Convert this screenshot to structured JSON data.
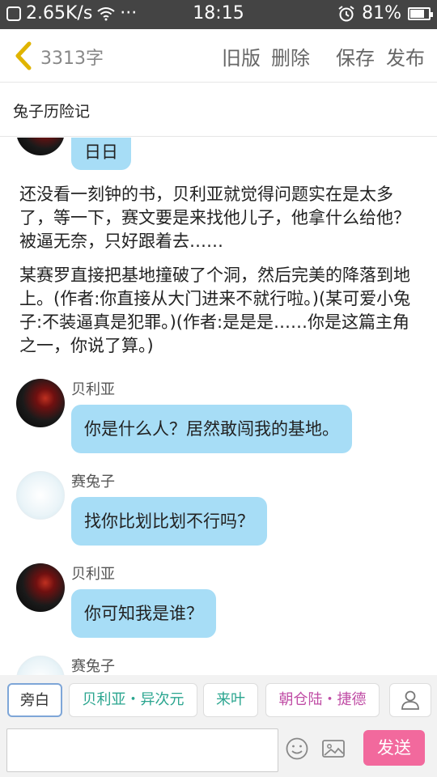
{
  "status_bar": {
    "speed": "2.65K/s",
    "more": "···",
    "time": "18:15",
    "battery": "81%",
    "battery_level": 0.81
  },
  "top_bar": {
    "word_count": "3313字",
    "old_version": "旧版",
    "delete": "删除",
    "save": "保存",
    "publish": "发布"
  },
  "story_title": "兔子历险记",
  "content": {
    "partial_bubble": "日日",
    "narration_1": "还没看一刻钟的书，贝利亚就觉得问题实在是太多了，等一下，赛文要是来找他儿子，他拿什么给他？被逼无奈，只好跟着去……",
    "narration_2": "某赛罗直接把基地撞破了个洞，然后完美的降落到地上。(作者:你直接从大门进来不就行啦。)(某可爱小兔子:不装逼真是犯罪。)(作者:是是是……你是这篇主角之一，你说了算。)",
    "messages": [
      {
        "speaker": "贝利亚",
        "text": "你是什么人？居然敢闯我的基地。"
      },
      {
        "speaker": "赛兔子",
        "text": "找你比划比划不行吗？"
      },
      {
        "speaker": "贝利亚",
        "text": "你可知我是谁？"
      },
      {
        "speaker": "赛兔子",
        "text": ""
      }
    ]
  },
  "roles": [
    "旁白",
    "贝利亚・异次元",
    "来叶",
    "朝仓陆・捷德"
  ],
  "input": {
    "placeholder": "",
    "send": "发送"
  },
  "colors": {
    "bubble": "#a7ddf6",
    "send": "#f2699d",
    "back_arrow": "#e0b400"
  }
}
